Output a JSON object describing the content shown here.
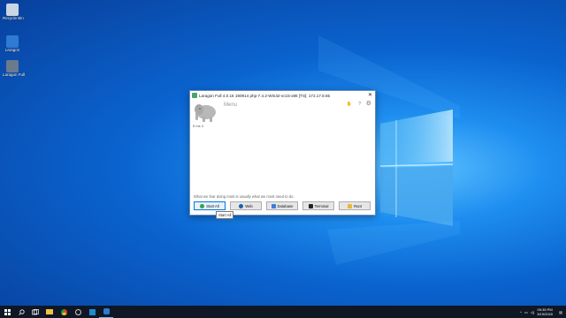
{
  "desktop": {
    "icons": [
      {
        "label": "Recycle Bin",
        "icon": "recycle-bin-icon"
      },
      {
        "label": "Laragon",
        "icon": "laragon-icon"
      },
      {
        "label": "Laragon Full",
        "icon": "installer-icon"
      }
    ]
  },
  "window": {
    "title": "Laragon Full 4.0.16 190914 php-7.4.2-Win32-vc15-x86 [TS]: 172.17.8.65",
    "close_glyph": "✕",
    "menu_label": "Menu",
    "version": "5 ms 4",
    "hint": "What we fear doing most is usually what we most need to do.",
    "buttons": [
      {
        "label": "Start All",
        "icon": "play-icon",
        "color": "#3aa04a"
      },
      {
        "label": "Web",
        "icon": "globe-icon",
        "color": "#1f5fa8"
      },
      {
        "label": "Database",
        "icon": "database-icon",
        "color": "#3b7dd8"
      },
      {
        "label": "Terminal",
        "icon": "terminal-icon",
        "color": "#222222"
      },
      {
        "label": "Root",
        "icon": "folder-icon",
        "color": "#e8b83a"
      }
    ],
    "tooltip": "Start All"
  },
  "taskbar": {
    "clock_time": "09:35 PM",
    "clock_date": "3/19/2020",
    "accent": "#0078d7"
  }
}
